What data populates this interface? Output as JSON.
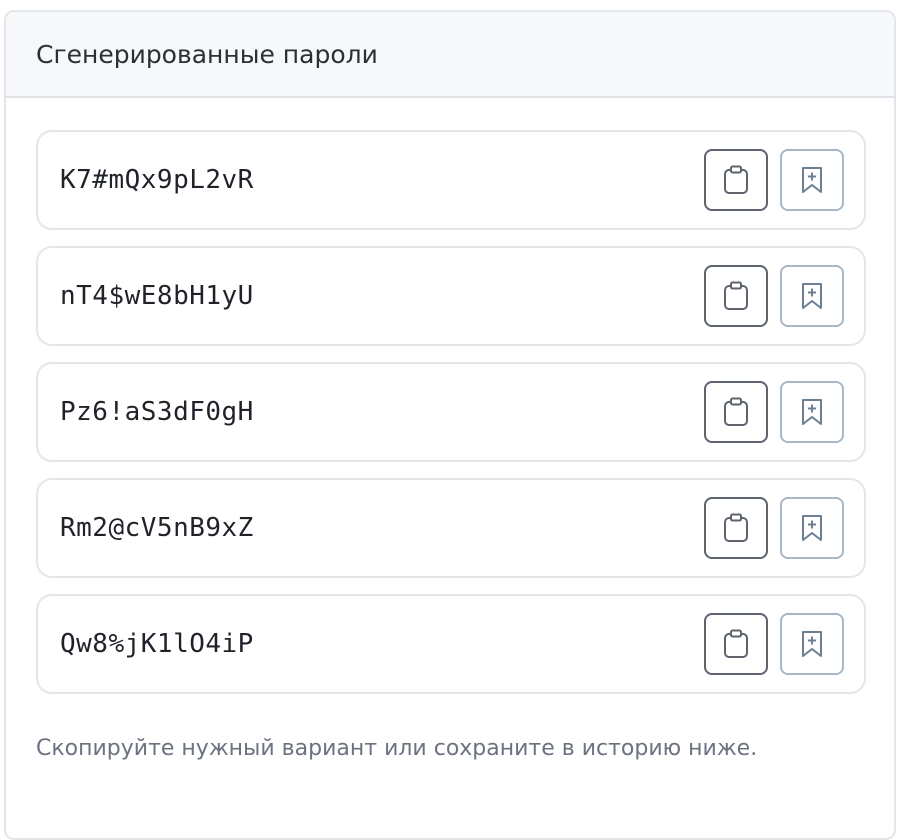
{
  "panel": {
    "title": "Сгенерированные пароли",
    "hint": "Скопируйте нужный вариант или сохраните в историю ниже."
  },
  "passwords": [
    {
      "value": "K7#mQx9pL2vR",
      "copy_icon": "clipboard-icon",
      "save_icon": "bookmark-plus-icon"
    },
    {
      "value": "nT4$wE8bH1yU",
      "copy_icon": "clipboard-icon",
      "save_icon": "bookmark-plus-icon"
    },
    {
      "value": "Pz6!aS3dF0gH",
      "copy_icon": "clipboard-icon",
      "save_icon": "bookmark-plus-icon"
    },
    {
      "value": "Rm2@cV5nB9xZ",
      "copy_icon": "clipboard-icon",
      "save_icon": "bookmark-plus-icon"
    },
    {
      "value": "Qw8%jK1lO4iP",
      "copy_icon": "clipboard-icon",
      "save_icon": "bookmark-plus-icon"
    }
  ],
  "colors": {
    "header_bg": "#f7f8fa",
    "border": "#e3e6ea",
    "copy_button_border": "#5d646e",
    "save_button_border": "#a9b6c6",
    "hint_text": "#6b7280"
  }
}
